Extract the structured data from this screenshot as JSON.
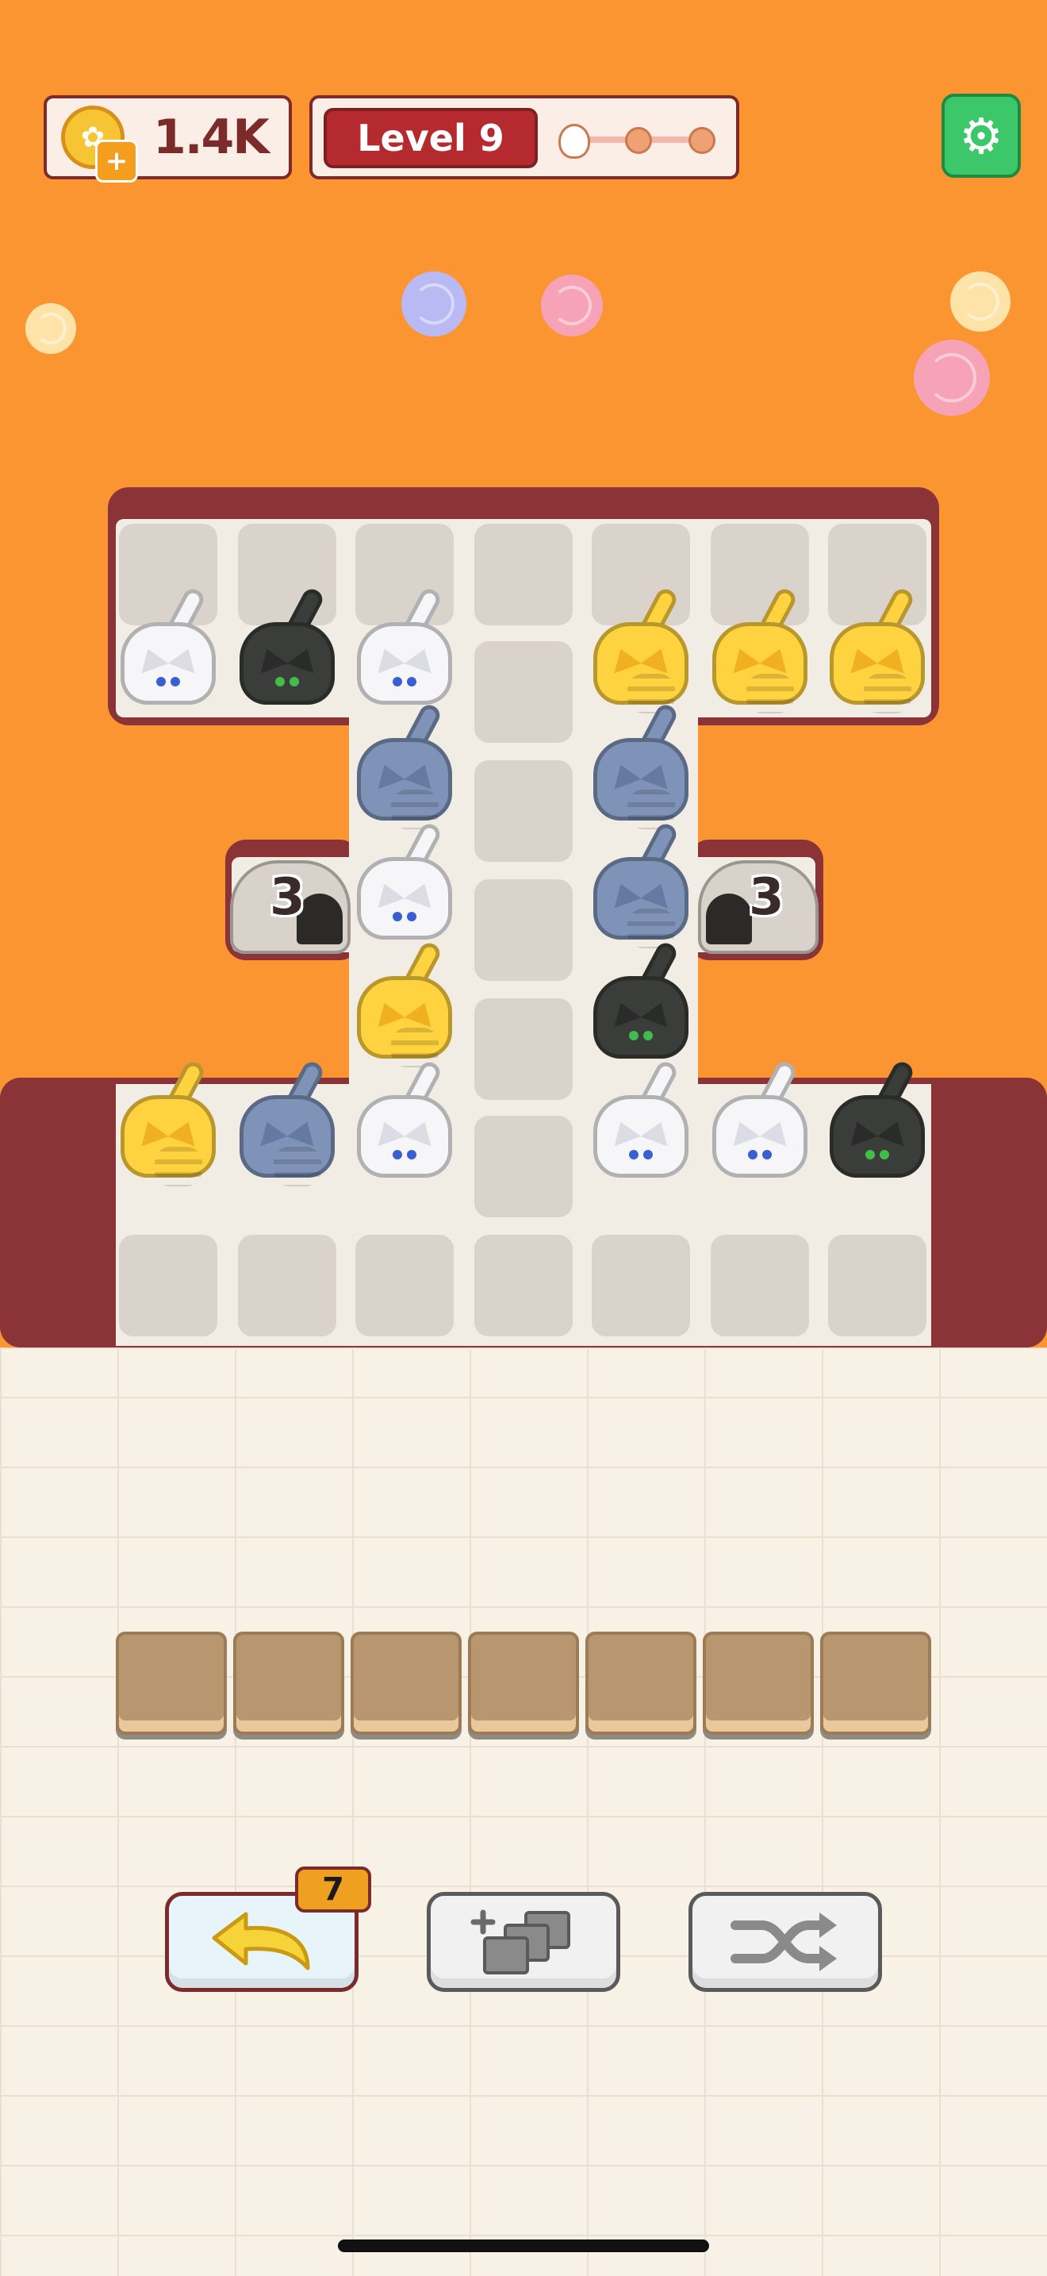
{
  "hud": {
    "coins": "1.4K",
    "coin_plus": "+",
    "level_label": "Level 9",
    "level_progress_stages": 3,
    "settings_icon": "gear-icon"
  },
  "holes": [
    {
      "count": "3"
    },
    {
      "count": "3"
    }
  ],
  "cats": {
    "top_row": [
      "white",
      "black",
      "white",
      "empty",
      "orange",
      "orange",
      "orange"
    ],
    "left_center_column": [
      "blue",
      "white",
      "orange"
    ],
    "right_center_column": [
      "blue",
      "blue",
      "black"
    ],
    "bottom_row": [
      "orange",
      "blue",
      "white",
      "empty",
      "white",
      "white",
      "black"
    ]
  },
  "colors": {
    "background": "#fb9532",
    "board": "#f2ede4",
    "border": "#8a3438",
    "white_cat": "#f6f6f8",
    "black_cat": "#3b3d3b",
    "orange_cat": "#ffd23f",
    "blue_cat": "#7f93b8"
  },
  "tray": {
    "slots": 7
  },
  "tools": {
    "undo_count": "7",
    "undo_icon": "undo-arrow-icon",
    "add_slot_icon": "add-tiles-icon",
    "shuffle_icon": "shuffle-icon"
  }
}
